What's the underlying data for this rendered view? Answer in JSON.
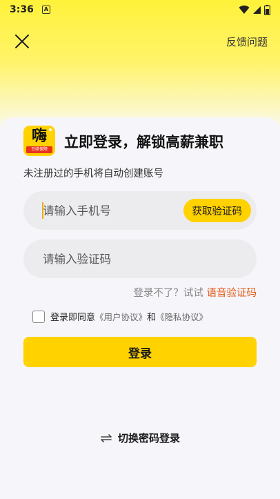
{
  "status_bar": {
    "time": "3:36",
    "notification_glyph": "A"
  },
  "header": {
    "feedback_label": "反馈问题"
  },
  "logo": {
    "char": "嗨",
    "sub": "日结保障"
  },
  "title": "立即登录，解锁高薪兼职",
  "subtitle": "未注册过的手机将自动创建账号",
  "phone_input": {
    "placeholder": "请输入手机号",
    "get_code_label": "获取验证码"
  },
  "code_input": {
    "placeholder": "请输入验证码"
  },
  "voice": {
    "prefix": "登录不了？试试 ",
    "link": "语音验证码"
  },
  "agreement": {
    "text": "登录即同意",
    "user_link": "《用户协议》",
    "and": "和",
    "privacy_link": "《隐私协议》"
  },
  "login_button": "登录",
  "switch_login": "切换密码登录",
  "colors": {
    "accent": "#ffd200",
    "link": "#e05a16"
  }
}
